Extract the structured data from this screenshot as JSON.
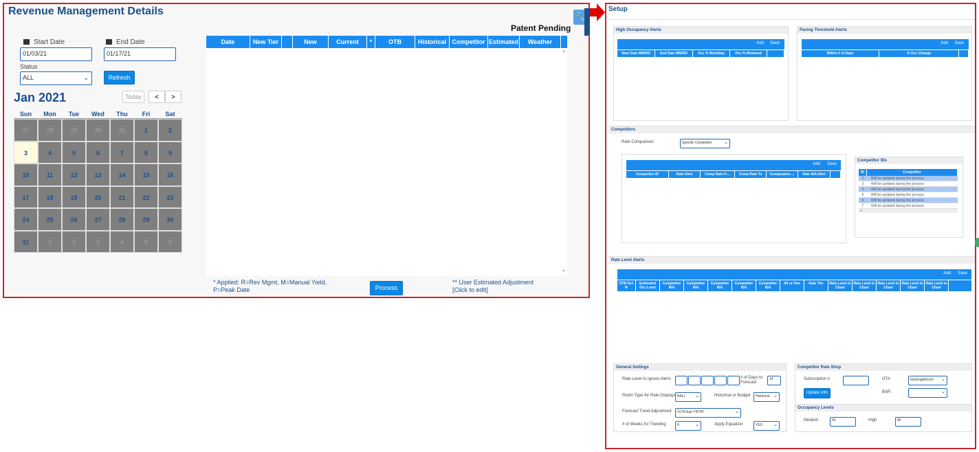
{
  "rm": {
    "title": "Revenue Management Details",
    "patent": "Patent Pending",
    "start_label": "Start Date",
    "start_value": "01/03/21",
    "end_label": "End Date",
    "end_value": "01/17/21",
    "status_label": "Status",
    "status_value": "ALL",
    "refresh": "Refresh",
    "month": "Jan 2021",
    "today": "Today",
    "prev": "<",
    "next": ">",
    "dow": [
      "Sun",
      "Mon",
      "Tue",
      "Wed",
      "Thu",
      "Fri",
      "Sat"
    ],
    "days": [
      {
        "n": "27",
        "t": "other"
      },
      {
        "n": "28",
        "t": "other"
      },
      {
        "n": "29",
        "t": "other"
      },
      {
        "n": "30",
        "t": "other"
      },
      {
        "n": "31",
        "t": "other"
      },
      {
        "n": "1",
        "t": ""
      },
      {
        "n": "2",
        "t": ""
      },
      {
        "n": "3",
        "t": "today"
      },
      {
        "n": "4",
        "t": ""
      },
      {
        "n": "5",
        "t": ""
      },
      {
        "n": "6",
        "t": ""
      },
      {
        "n": "7",
        "t": ""
      },
      {
        "n": "8",
        "t": ""
      },
      {
        "n": "9",
        "t": ""
      },
      {
        "n": "10",
        "t": ""
      },
      {
        "n": "11",
        "t": ""
      },
      {
        "n": "12",
        "t": ""
      },
      {
        "n": "13",
        "t": ""
      },
      {
        "n": "14",
        "t": ""
      },
      {
        "n": "15",
        "t": ""
      },
      {
        "n": "16",
        "t": ""
      },
      {
        "n": "17",
        "t": ""
      },
      {
        "n": "18",
        "t": ""
      },
      {
        "n": "19",
        "t": ""
      },
      {
        "n": "20",
        "t": ""
      },
      {
        "n": "21",
        "t": ""
      },
      {
        "n": "22",
        "t": ""
      },
      {
        "n": "23",
        "t": ""
      },
      {
        "n": "24",
        "t": ""
      },
      {
        "n": "25",
        "t": ""
      },
      {
        "n": "26",
        "t": ""
      },
      {
        "n": "27",
        "t": ""
      },
      {
        "n": "28",
        "t": ""
      },
      {
        "n": "29",
        "t": ""
      },
      {
        "n": "30",
        "t": ""
      },
      {
        "n": "31",
        "t": ""
      },
      {
        "n": "1",
        "t": "other"
      },
      {
        "n": "2",
        "t": "other"
      },
      {
        "n": "3",
        "t": "other"
      },
      {
        "n": "4",
        "t": "other"
      },
      {
        "n": "5",
        "t": "other"
      },
      {
        "n": "6",
        "t": "other"
      }
    ],
    "columns": [
      "Date",
      "New Tier",
      "",
      "New",
      "Current",
      "*",
      "OTB",
      "Historical",
      "Competitor",
      "Estimated",
      "Weather"
    ],
    "foot_left": "* Applied: R=Rev Mgmt, M=Manual Yield, P=Peak Date",
    "process": "Process",
    "foot_right_1": "** User Estimated Adjustment",
    "foot_right_2": "[Click to edit]"
  },
  "setup": {
    "title": "Setup",
    "add": "Add",
    "save": "Save",
    "hoa_title": "High Occupancy Alerts",
    "hoa_cols": [
      "Start Date MM/DD",
      "End Date MM/DD",
      "Occ % WeekDay",
      "Occ % Weekend",
      ""
    ],
    "pta_title": "Pacing Threshold Alerts",
    "pta_cols": [
      "Within # of Days",
      "% Occ Change",
      ""
    ],
    "comp_title": "Competitors",
    "rate_comparison_label": "Rate Comparison",
    "rate_comparison_value": "Specific Competitor",
    "comp_cols": [
      "Competitor ID",
      "Rate Alert",
      "Comp Rate Fr...",
      "Comp Rate To",
      "Comparative ...",
      "Rate N/A Alert",
      ""
    ],
    "compid_title": "Competitor IDs",
    "compid_cols": [
      "ID",
      "Competitor"
    ],
    "compid_rows": [
      {
        "id": "2",
        "name": "Will be updated during the process",
        "b": true
      },
      {
        "id": "3",
        "name": "Will be updated during the process",
        "b": false
      },
      {
        "id": "4",
        "name": "Will be updated during the process",
        "b": true
      },
      {
        "id": "5",
        "name": "Will be updated during the process",
        "b": false
      },
      {
        "id": "6",
        "name": "Will be updated during the process",
        "b": true
      },
      {
        "id": "7",
        "name": "Will be updated during the process",
        "b": false
      }
    ],
    "rla_title": "Rate Level Alerts",
    "rla_cols": [
      "OTB Occ %",
      "Estimated Occ Level",
      "Competitor N/A",
      "Competitor N/A",
      "Competitor N/A",
      "Competitor N/A",
      "Competitor N/A",
      "All or One",
      "Rate Tier",
      "Rate Level to Close",
      "Rate Level to Close",
      "Rate Level to Close",
      "Rate Level to Close",
      "Rate Level to Close"
    ],
    "gs_title": "General Settings",
    "gs_rate_level_label": "Rate Level to Ignore Alerts",
    "gs_days_label": "# of Days to Forecast",
    "gs_days_value": "14",
    "gs_roomtype_label": "Room Type for Rate Displays",
    "gs_roomtype_value": "BALL",
    "gs_histbud_label": "Historical or Budget",
    "gs_histbud_value": "Historical",
    "gs_trend_label": "Forecast Trend Adjustment",
    "gs_trend_value": "#3 Pickup YR/YR",
    "gs_weeks_label": "# of Weeks for Trending",
    "gs_weeks_value": "8",
    "gs_equalizer_label": "Apply Equalizer",
    "gs_equalizer_value": "YES",
    "crs_title": "Competitor Rate Shop",
    "crs_sub_label": "Subscription #",
    "crs_ota_label": "OTA",
    "crs_ota_value": "bookingdotcom",
    "crs_bar_label": "BAR",
    "crs_update": "Update Info",
    "occ_title": "Occupancy Levels",
    "occ_medium_label": "Medium",
    "occ_medium_value": "66",
    "occ_high_label": "High",
    "occ_high_value": "80"
  }
}
